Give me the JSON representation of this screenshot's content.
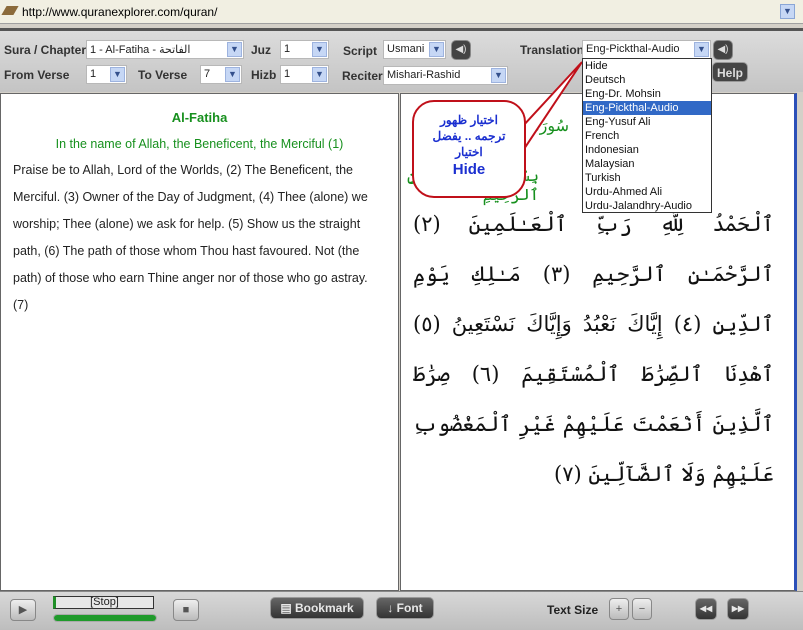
{
  "browser": {
    "url": "http://www.quranexplorer.com/quran/"
  },
  "toolbar": {
    "sura_label": "Sura / Chapter",
    "sura_value": "1 - Al-Fatiha - الفاتحة",
    "juz_label": "Juz",
    "juz_value": "1",
    "script_label": "Script",
    "script_value": "Usmani",
    "translation_label": "Translation",
    "translation_value": "Eng-Pickthal-Audio",
    "from_label": "From Verse",
    "from_value": "1",
    "to_label": "To Verse",
    "to_value": "7",
    "hizb_label": "Hizb",
    "hizb_value": "1",
    "reciter_label": "Reciter",
    "reciter_value": "Mishari-Rashid",
    "help_label": "Help"
  },
  "translation_menu": {
    "options": [
      "Hide",
      "Deutsch",
      "Eng-Dr. Mohsin",
      "Eng-Pickthal-Audio",
      "Eng-Yusuf Ali",
      "French",
      "Indonesian",
      "Malaysian",
      "Turkish",
      "Urdu-Ahmed Ali",
      "Urdu-Jalandhry-Audio"
    ],
    "selected": "Eng-Pickthal-Audio"
  },
  "callout": {
    "line1": "اختيار ظهور",
    "line2": "ترجمه .. يفضل",
    "line3": "اختيار",
    "line4": "Hide"
  },
  "left_pane": {
    "title": "Al-Fatiha",
    "bismillah": "In the name of Allah, the Beneficent, the Merciful (1)",
    "text": "Praise be to Allah, Lord of the Worlds, (2) The Beneficent, the Merciful. (3) Owner of the Day of Judgment, (4) Thee (alone) we worship; Thee (alone) we ask for help. (5) Show us the straight path, (6) The path of those whom Thou hast favoured. Not (the path) of those who earn Thine anger nor of those who go astray. (7)"
  },
  "right_pane": {
    "header": "سُورَةُ الفَاتِحَة",
    "bismillah": "بِسْمِ ٱللَّهِ ٱلرَّحْمَـٰنِ ٱلرَّحِيمِ",
    "text": "ٱلْحَمْدُ لِلَّهِ رَبِّ ٱلْعَـٰلَمِينَ (٢) ٱلرَّحْمَـٰنِ ٱلرَّحِيمِ (٣) مَـٰلِكِ يَوْمِ ٱلدِّينِ (٤) إِيَّاكَ نَعْبُدُ وَإِيَّاكَ نَسْتَعِينُ (٥) ٱهْدِنَا ٱلصِّرَٰطَ ٱلْمُسْتَقِيمَ (٦) صِرَٰطَ ٱلَّذِينَ أَنْعَمْتَ عَلَيْهِمْ غَيْرِ ٱلْمَغْضُوبِ عَلَيْهِمْ وَلَا ٱلضَّآلِّينَ (٧)"
  },
  "player": {
    "status": "[Stop]",
    "progress": 1.0,
    "bookmark_label": "Bookmark",
    "font_label": "Font",
    "text_size_label": "Text Size"
  }
}
